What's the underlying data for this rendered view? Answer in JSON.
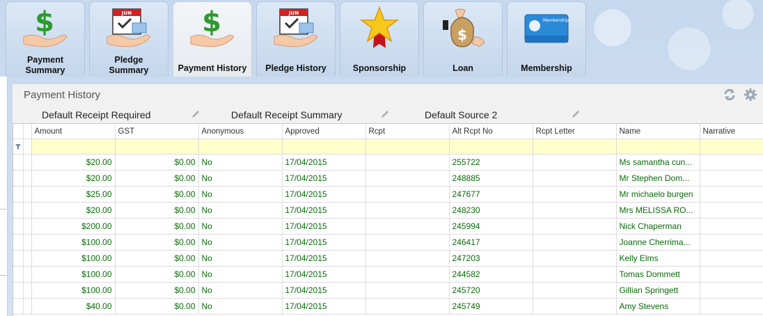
{
  "tabs": [
    {
      "label": "Payment Summary",
      "lines": [
        "Payment",
        "Summary"
      ],
      "icon": "money-hand-icon",
      "active": false
    },
    {
      "label": "Pledge Summary",
      "lines": [
        "Pledge",
        "Summary"
      ],
      "icon": "calendar-money-icon",
      "active": false
    },
    {
      "label": "Payment History",
      "lines": [
        "Payment History"
      ],
      "icon": "money-hand-icon",
      "active": true
    },
    {
      "label": "Pledge History",
      "lines": [
        "Pledge History"
      ],
      "icon": "calendar-money-icon",
      "active": false
    },
    {
      "label": "Sponsorship",
      "lines": [
        "Sponsorship"
      ],
      "icon": "star-ribbon-icon",
      "active": false
    },
    {
      "label": "Loan",
      "lines": [
        "Loan"
      ],
      "icon": "money-bag-hand-icon",
      "active": false
    },
    {
      "label": "Membership",
      "lines": [
        "Membership"
      ],
      "icon": "membership-card-icon",
      "active": false
    }
  ],
  "calendar_month": "JUN",
  "membership_card_text": "Membership",
  "panel": {
    "title": "Payment History",
    "refresh_icon": "refresh-icon",
    "settings_icon": "gear-icon"
  },
  "defaults": {
    "receipt_required": "Default Receipt Required",
    "receipt_summary": "Default Receipt Summary",
    "source": "Default Source 2"
  },
  "columns": [
    "Amount",
    "GST",
    "Anonymous",
    "Approved",
    "Rcpt",
    "Alt Rcpt No",
    "Rcpt Letter",
    "Name",
    "Narrative"
  ],
  "rows": [
    {
      "amount": "$20.00",
      "gst": "$0.00",
      "anonymous": "No",
      "approved": "17/04/2015",
      "rcpt": "",
      "alt_rcpt_no": "255722",
      "rcpt_letter": "",
      "name": "Ms samantha cun...",
      "narrative": ""
    },
    {
      "amount": "$20.00",
      "gst": "$0.00",
      "anonymous": "No",
      "approved": "17/04/2015",
      "rcpt": "",
      "alt_rcpt_no": "248885",
      "rcpt_letter": "",
      "name": "Mr Stephen Dom...",
      "narrative": ""
    },
    {
      "amount": "$25.00",
      "gst": "$0.00",
      "anonymous": "No",
      "approved": "17/04/2015",
      "rcpt": "",
      "alt_rcpt_no": "247677",
      "rcpt_letter": "",
      "name": "Mr michaelo burgen",
      "narrative": ""
    },
    {
      "amount": "$20.00",
      "gst": "$0.00",
      "anonymous": "No",
      "approved": "17/04/2015",
      "rcpt": "",
      "alt_rcpt_no": "248230",
      "rcpt_letter": "",
      "name": "Mrs MELISSA RO...",
      "narrative": ""
    },
    {
      "amount": "$200.00",
      "gst": "$0.00",
      "anonymous": "No",
      "approved": "17/04/2015",
      "rcpt": "",
      "alt_rcpt_no": "245994",
      "rcpt_letter": "",
      "name": " Nick Chaperman",
      "narrative": ""
    },
    {
      "amount": "$100.00",
      "gst": "$0.00",
      "anonymous": "No",
      "approved": "17/04/2015",
      "rcpt": "",
      "alt_rcpt_no": "246417",
      "rcpt_letter": "",
      "name": " Joanne Cherrima...",
      "narrative": ""
    },
    {
      "amount": "$100.00",
      "gst": "$0.00",
      "anonymous": "No",
      "approved": "17/04/2015",
      "rcpt": "",
      "alt_rcpt_no": "247203",
      "rcpt_letter": "",
      "name": " Kelly Elms",
      "narrative": ""
    },
    {
      "amount": "$100.00",
      "gst": "$0.00",
      "anonymous": "No",
      "approved": "17/04/2015",
      "rcpt": "",
      "alt_rcpt_no": "244582",
      "rcpt_letter": "",
      "name": " Tomas Dommett",
      "narrative": ""
    },
    {
      "amount": "$100.00",
      "gst": "$0.00",
      "anonymous": "No",
      "approved": "17/04/2015",
      "rcpt": "",
      "alt_rcpt_no": "245720",
      "rcpt_letter": "",
      "name": " Gillian Springett",
      "narrative": ""
    },
    {
      "amount": "$40.00",
      "gst": "$0.00",
      "anonymous": "No",
      "approved": "17/04/2015",
      "rcpt": "",
      "alt_rcpt_no": "245749",
      "rcpt_letter": "",
      "name": " Amy Stevens",
      "narrative": ""
    }
  ],
  "colors": {
    "data_text": "#0a6a0a",
    "filter_row": "#ffffcc",
    "accent": "#2b8ad8"
  }
}
